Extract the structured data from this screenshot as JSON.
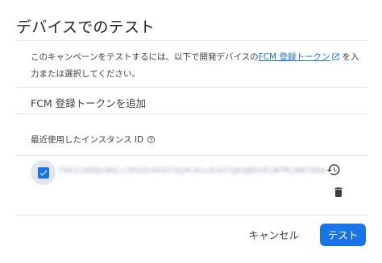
{
  "dialog": {
    "title": "デバイスでのテスト",
    "description_before": "このキャンペーンをテストするには、以下で開発デバイスの",
    "description_link": "FCM 登録トークン",
    "description_after": "を入力または選択してください。",
    "add_token_label": "FCM 登録トークンを追加",
    "recent_label": "最近使用したインスタンス ID",
    "token_placeholder_masked": "fXk3Jd9Qx8mLr2PwZn6VbT4yHcA1sEoU7gKqN5tRiWfMjB0lD9aYpS3vCxGhE2nQ",
    "checkbox_checked": true,
    "buttons": {
      "cancel": "キャンセル",
      "test": "テスト"
    }
  },
  "colors": {
    "accent": "#1a73e8"
  },
  "icons": [
    "external-link-icon",
    "help-icon",
    "check-icon",
    "history-icon",
    "delete-icon"
  ]
}
